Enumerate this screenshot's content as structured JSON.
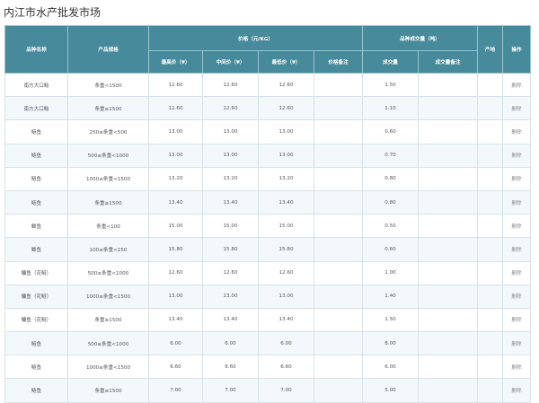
{
  "page": {
    "title": "内江市水产批发市场"
  },
  "table": {
    "headers": {
      "variety": "品种名称",
      "spec": "产品规格",
      "price_group": "价格（元/KG）",
      "volume_group": "品种成交量（吨）",
      "origin": "产地",
      "action": "操作",
      "price_high": "最高价（¥）",
      "price_mid": "中间价（¥）",
      "price_low": "最低价（¥）",
      "price_note": "价格备注",
      "volume": "成交量",
      "volume_note": "成交量备注"
    },
    "rows": [
      {
        "variety": "南方大口鲶",
        "spec": "条重<1500",
        "high": "12.60",
        "mid": "12.60",
        "low": "12.60",
        "price_note": "",
        "volume": "1.50",
        "volume_note": "",
        "origin": "",
        "action": "删除"
      },
      {
        "variety": "南方大口鲶",
        "spec": "条重≥1500",
        "high": "12.60",
        "mid": "12.60",
        "low": "12.60",
        "price_note": "",
        "volume": "1.10",
        "volume_note": "",
        "origin": "",
        "action": "删除"
      },
      {
        "variety": "鲢鱼",
        "spec": "250≤条重<500",
        "high": "13.00",
        "mid": "13.00",
        "low": "13.00",
        "price_note": "",
        "volume": "0.60",
        "volume_note": "",
        "origin": "",
        "action": "删除"
      },
      {
        "variety": "鲢鱼",
        "spec": "500≤条重<1000",
        "high": "13.00",
        "mid": "13.00",
        "low": "13.00",
        "price_note": "",
        "volume": "0.70",
        "volume_note": "",
        "origin": "",
        "action": "删除"
      },
      {
        "variety": "鲢鱼",
        "spec": "1000≤条重<1500",
        "high": "13.20",
        "mid": "13.20",
        "low": "13.20",
        "price_note": "",
        "volume": "0.80",
        "volume_note": "",
        "origin": "",
        "action": "删除"
      },
      {
        "variety": "鲢鱼",
        "spec": "条重≥1500",
        "high": "13.40",
        "mid": "13.40",
        "low": "13.40",
        "price_note": "",
        "volume": "0.80",
        "volume_note": "",
        "origin": "",
        "action": "删除"
      },
      {
        "variety": "鲫鱼",
        "spec": "条重<100",
        "high": "15.00",
        "mid": "15.00",
        "low": "15.00",
        "price_note": "",
        "volume": "0.50",
        "volume_note": "",
        "origin": "",
        "action": "删除"
      },
      {
        "variety": "鲫鱼",
        "spec": "100≤条重<250",
        "high": "15.80",
        "mid": "15.80",
        "low": "15.80",
        "price_note": "",
        "volume": "0.60",
        "volume_note": "",
        "origin": "",
        "action": "删除"
      },
      {
        "variety": "鳙鱼（花鲢）",
        "spec": "500≤条重<1000",
        "high": "12.60",
        "mid": "12.60",
        "low": "12.60",
        "price_note": "",
        "volume": "1.00",
        "volume_note": "",
        "origin": "",
        "action": "删除"
      },
      {
        "variety": "鳙鱼（花鲢）",
        "spec": "1000≤条重<1500",
        "high": "13.00",
        "mid": "13.00",
        "low": "13.00",
        "price_note": "",
        "volume": "1.40",
        "volume_note": "",
        "origin": "",
        "action": "删除"
      },
      {
        "variety": "鳙鱼（花鲢）",
        "spec": "条重≥1500",
        "high": "13.40",
        "mid": "13.40",
        "low": "13.40",
        "price_note": "",
        "volume": "1.50",
        "volume_note": "",
        "origin": "",
        "action": "删除"
      },
      {
        "variety": "鲢鱼",
        "spec": "500≤条重<1000",
        "high": "6.00",
        "mid": "6.00",
        "low": "6.00",
        "price_note": "",
        "volume": "8.00",
        "volume_note": "",
        "origin": "",
        "action": "删除"
      },
      {
        "variety": "鲢鱼",
        "spec": "1000≤条重<1500",
        "high": "6.60",
        "mid": "6.60",
        "low": "6.60",
        "price_note": "",
        "volume": "6.00",
        "volume_note": "",
        "origin": "",
        "action": "删除"
      },
      {
        "variety": "鲢鱼",
        "spec": "条重≥1500",
        "high": "7.00",
        "mid": "7.00",
        "low": "7.00",
        "price_note": "",
        "volume": "5.00",
        "volume_note": "",
        "origin": "",
        "action": "删除"
      }
    ]
  }
}
